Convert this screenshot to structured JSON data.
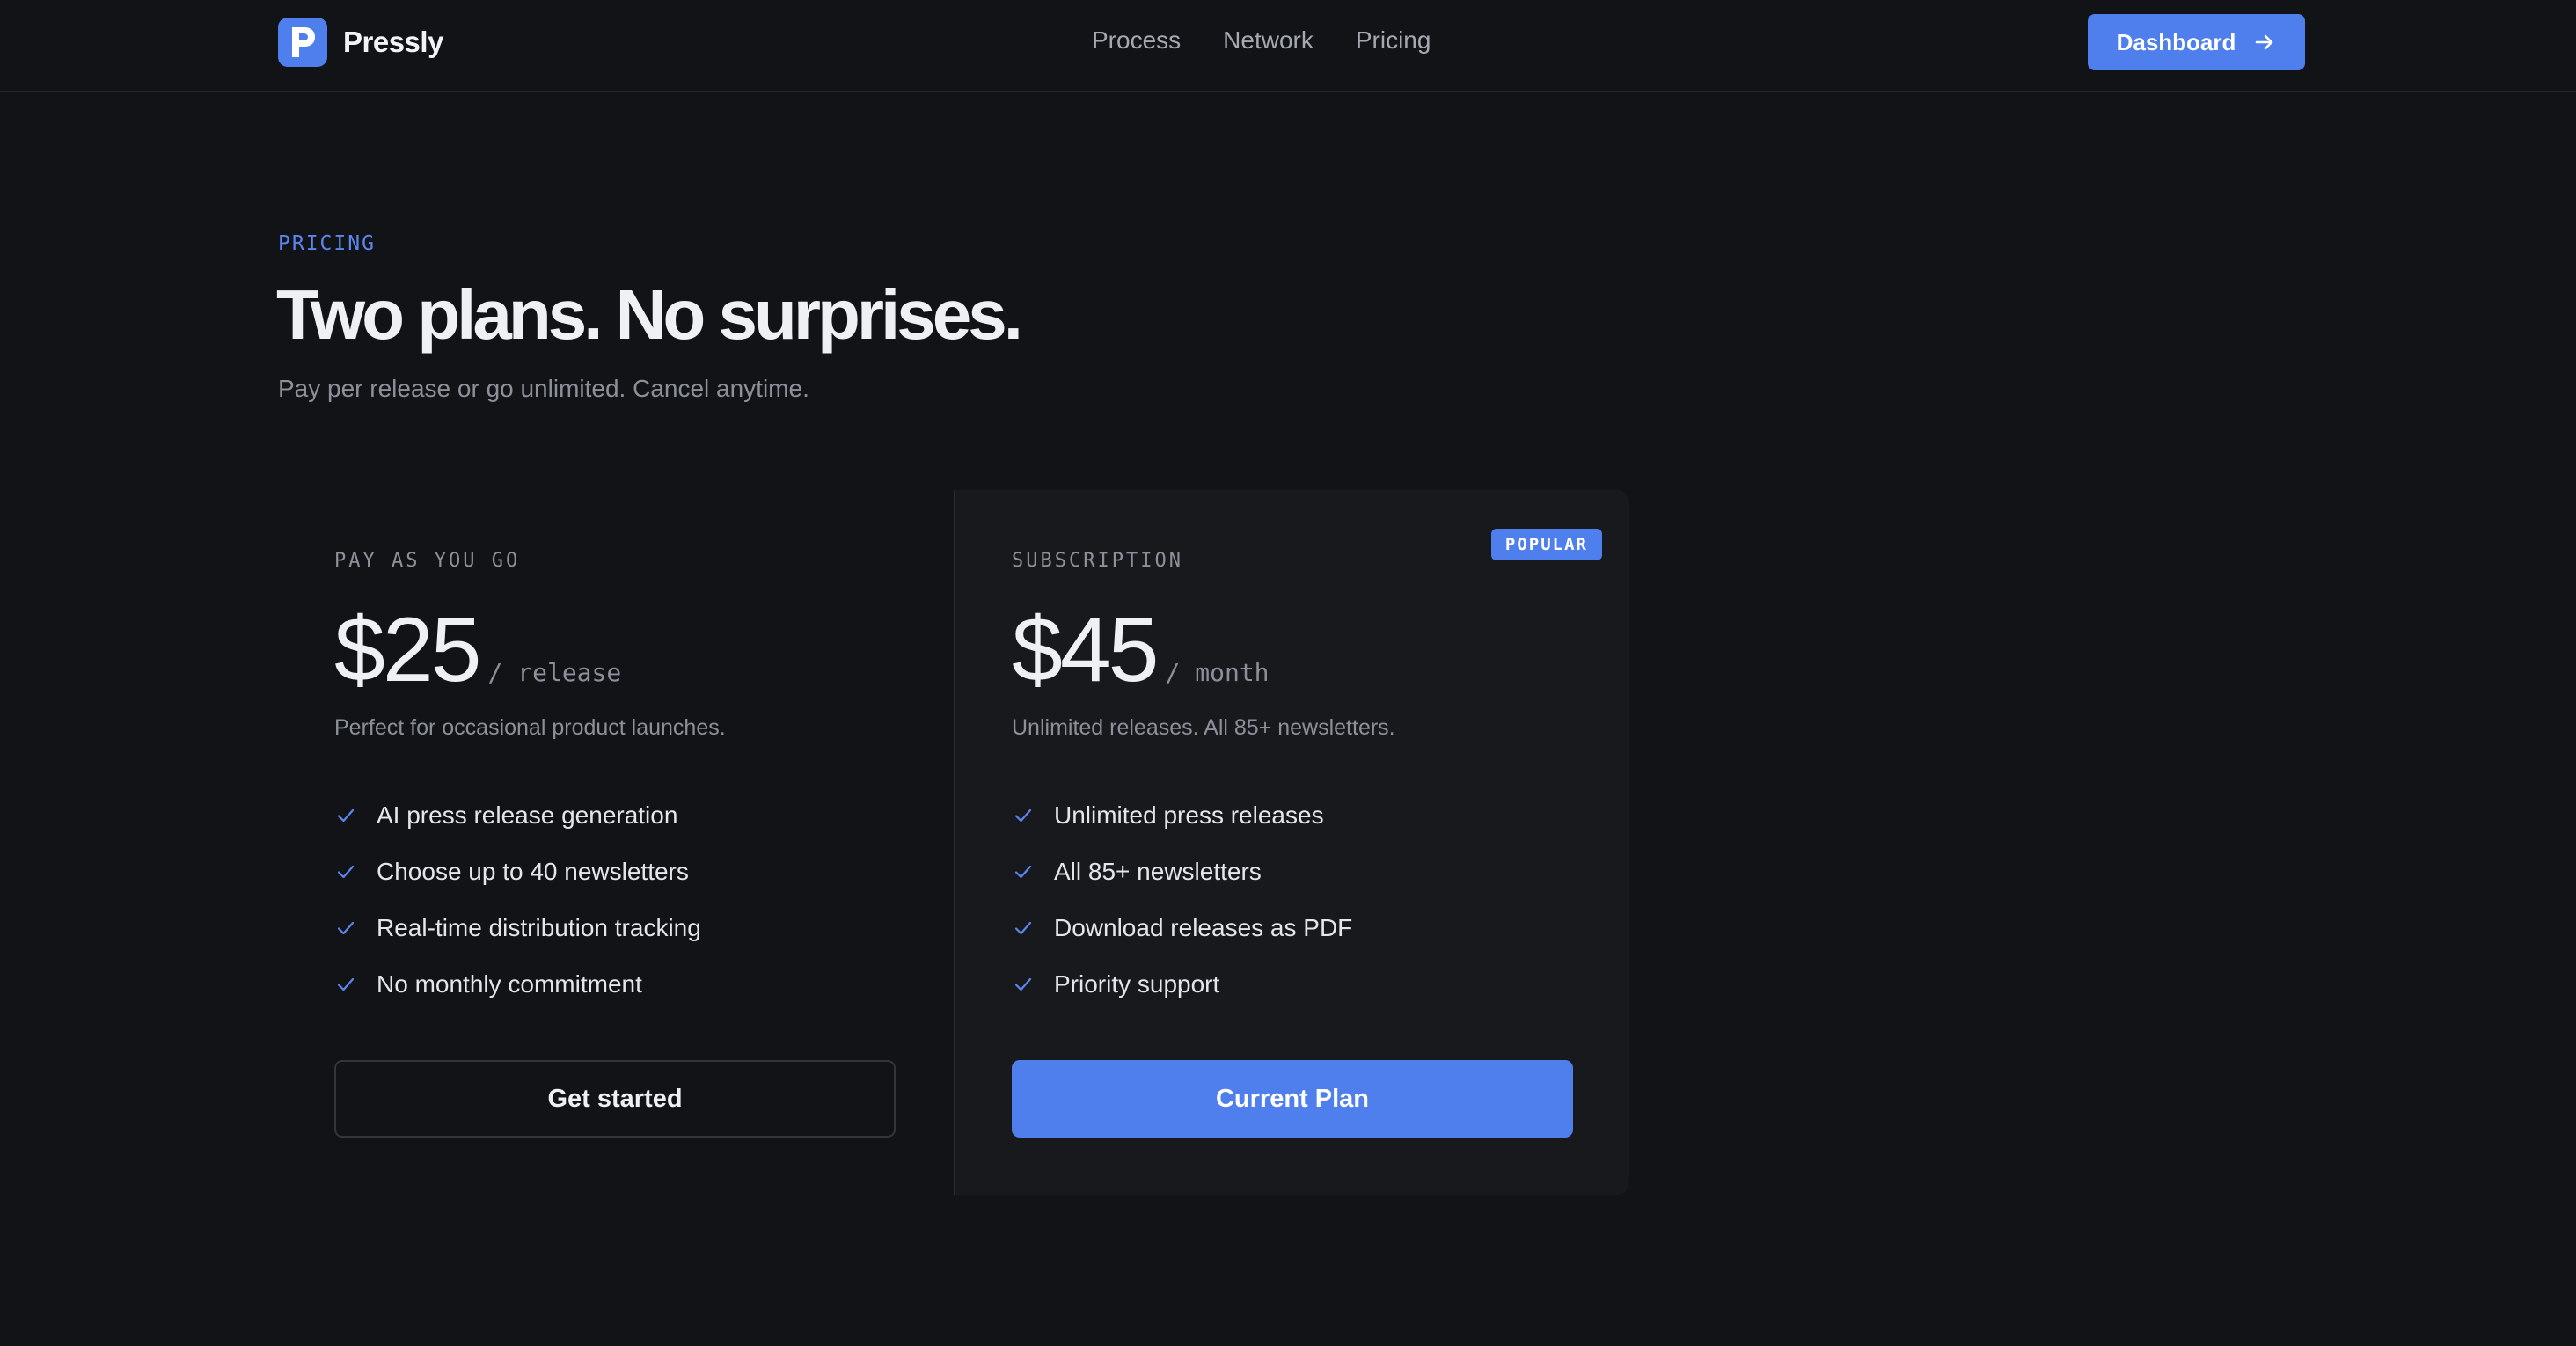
{
  "brand": {
    "logo_letter": "P",
    "name": "Pressly"
  },
  "nav": {
    "items": [
      "Process",
      "Network",
      "Pricing"
    ]
  },
  "header": {
    "dashboard_label": "Dashboard"
  },
  "hero": {
    "eyebrow": "PRICING",
    "title": "Two plans. No surprises.",
    "subtitle": "Pay per release or go unlimited. Cancel anytime."
  },
  "plans": [
    {
      "name": "PAY AS YOU GO",
      "price": "$25",
      "period": "/ release",
      "description": "Perfect for occasional product launches.",
      "features": [
        "AI press release generation",
        "Choose up to 40 newsletters",
        "Real-time distribution tracking",
        "No monthly commitment"
      ],
      "button": "Get started"
    },
    {
      "name": "SUBSCRIPTION",
      "badge": "POPULAR",
      "price": "$45",
      "period": "/ month",
      "description": "Unlimited releases. All 85+ newsletters.",
      "features": [
        "Unlimited press releases",
        "All 85+ newsletters",
        "Download releases as PDF",
        "Priority support"
      ],
      "button": "Current Plan"
    }
  ],
  "colors": {
    "background": "#121316",
    "card": "#18191d",
    "accent": "#4f7fec",
    "muted_text": "#8c909b"
  },
  "icons": [
    "arrow-right-icon",
    "check-icon"
  ]
}
